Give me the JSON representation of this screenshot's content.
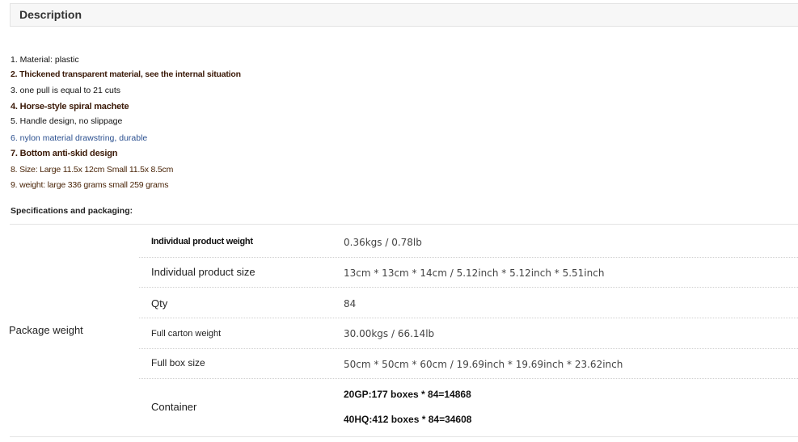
{
  "description": {
    "title": "Description",
    "features": [
      "1. Material: plastic",
      "2. Thickened transparent material, see the internal situation",
      "3. one pull is equal to 21 cuts",
      "4. Horse-style spiral machete",
      "5. Handle design, no slippage",
      "6. nylon material drawstring, durable",
      "7. Bottom anti-skid design",
      "8. Size: Large 11.5x 12cm Small 11.5x 8.5cm",
      "9. weight: large 336 grams small 259 grams"
    ]
  },
  "specs": {
    "title": "Specifications and packaging:",
    "group_label": "Package weight",
    "rows": [
      {
        "label": "Individual product weight",
        "value": "0.36kgs / 0.78lb"
      },
      {
        "label": "Individual product size",
        "value": "13cm * 13cm * 14cm / 5.12inch * 5.12inch * 5.51inch"
      },
      {
        "label": "Qty",
        "value": "84"
      },
      {
        "label": "Full carton weight",
        "value": "30.00kgs / 66.14lb"
      },
      {
        "label": "Full box size",
        "value": "50cm * 50cm * 60cm / 19.69inch * 19.69inch * 23.62inch"
      },
      {
        "label": "Container",
        "values": [
          "20GP:177 boxes * 84=14868",
          "40HQ:412 boxes * 84=34608"
        ]
      }
    ]
  }
}
